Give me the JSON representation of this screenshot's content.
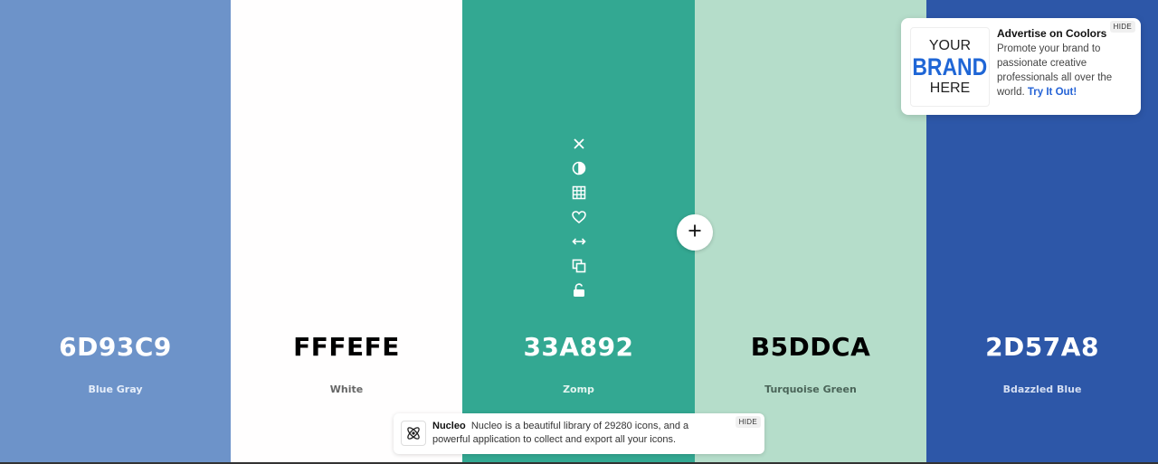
{
  "palette": [
    {
      "hex": "6D93C9",
      "name": "Blue Gray",
      "bg": "#6D93C9",
      "text_color": "#ffffff",
      "name_color": "#e6eefa",
      "width": 255
    },
    {
      "hex": "FFFEFE",
      "name": "White",
      "bg": "#FFFEFE",
      "text_color": "#000000",
      "name_color": "#666666",
      "width": 256
    },
    {
      "hex": "33A892",
      "name": "Zomp",
      "bg": "#33A892",
      "text_color": "#ffffff",
      "name_color": "#e3f5f0",
      "width": 257
    },
    {
      "hex": "B5DDCA",
      "name": "Turquoise Green",
      "bg": "#B5DDCA",
      "text_color": "#000000",
      "name_color": "#4a6458",
      "width": 256
    },
    {
      "hex": "2D57A8",
      "name": "Bdazzled Blue",
      "bg": "#2D57A8",
      "text_color": "#ffffff",
      "name_color": "#d4def2",
      "width": 256
    }
  ],
  "tools": [
    "close-icon",
    "contrast-icon",
    "grid-icon",
    "heart-icon",
    "drag-horizontal-icon",
    "copy-icon",
    "unlock-icon"
  ],
  "add_button": {
    "icon": "plus-icon"
  },
  "ad": {
    "title": "Advertise on Coolors",
    "text": "Promote your brand to passionate creative professionals all over the world.",
    "link": "Try It Out!",
    "hide": "HIDE",
    "logo": {
      "line1": "YOUR",
      "line2": "BRAND",
      "line3": "HERE"
    }
  },
  "nucleo": {
    "title": "Nucleo",
    "text": "Nucleo is a beautiful library of 29280 icons, and a powerful application to collect and export all your icons.",
    "hide": "HIDE"
  }
}
